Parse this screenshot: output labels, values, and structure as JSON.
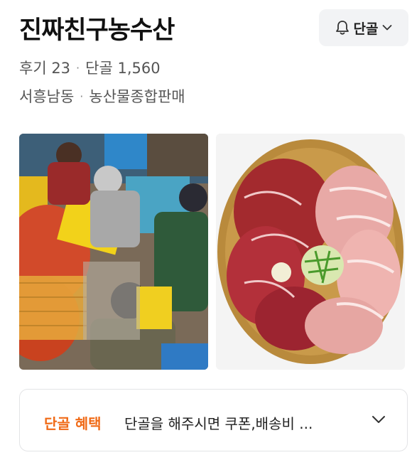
{
  "store": {
    "name": "진짜친구농수산",
    "regular_button_label": "단골",
    "reviews": "후기 23",
    "regulars": "단골 1,560",
    "location": "서흥남동",
    "category": "농산물종합판매"
  },
  "benefit": {
    "title": "단골 혜택",
    "text": "단골을 해주시면 쿠폰,배송비 ..."
  },
  "photos": [
    {
      "icon": "crab-market-photo"
    },
    {
      "icon": "meat-platter-photo"
    }
  ],
  "colors": {
    "accent": "#f06a16",
    "button_bg": "#f2f3f5",
    "secondary_text": "#555555"
  }
}
